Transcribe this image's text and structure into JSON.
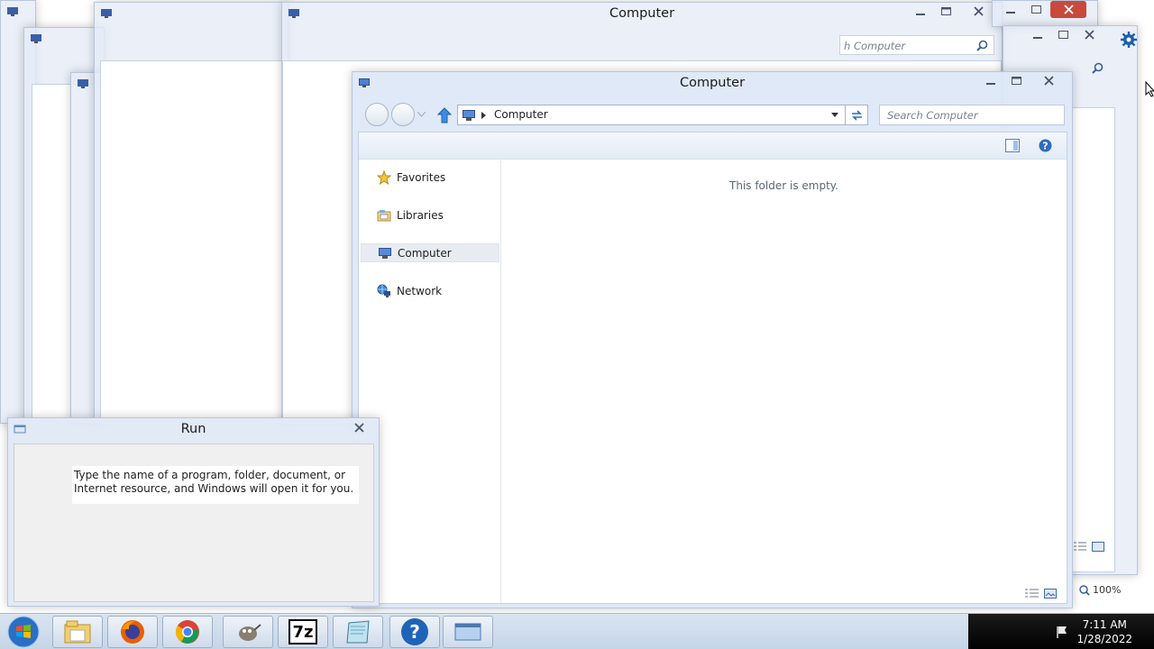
{
  "background_windows": {
    "main_title": "Computer",
    "search_placeholder": "Search Computer",
    "search_partial": "h Computer"
  },
  "explorer": {
    "title": "Computer",
    "address_path": "Computer",
    "search_placeholder": "Search Computer",
    "nav_items": [
      {
        "label": "Favorites",
        "icon": "star-icon"
      },
      {
        "label": "Libraries",
        "icon": "libraries-icon"
      },
      {
        "label": "Computer",
        "icon": "computer-icon",
        "selected": true
      },
      {
        "label": "Network",
        "icon": "network-icon"
      }
    ],
    "empty_message": "This folder is empty."
  },
  "run_dialog": {
    "title": "Run",
    "message": "Type the name of a program, folder, document, or Internet resource, and Windows will open it for you."
  },
  "taskbar": {
    "pinned": [
      "windows-explorer-icon",
      "firefox-icon",
      "chrome-icon",
      "gimp-icon",
      "7zip-icon",
      "notepad-icon",
      "help-icon",
      "window-icon"
    ],
    "sevenzip_label": "7z",
    "help_label": "?",
    "clock_time": "7:11 AM",
    "clock_date": "1/28/2022"
  },
  "zoom_level": "100%",
  "colors": {
    "window_frame": "#dfe8f6",
    "taskbar": "#cfdbeb",
    "close_red": "#c0392b",
    "clock_bg": "#000000"
  }
}
